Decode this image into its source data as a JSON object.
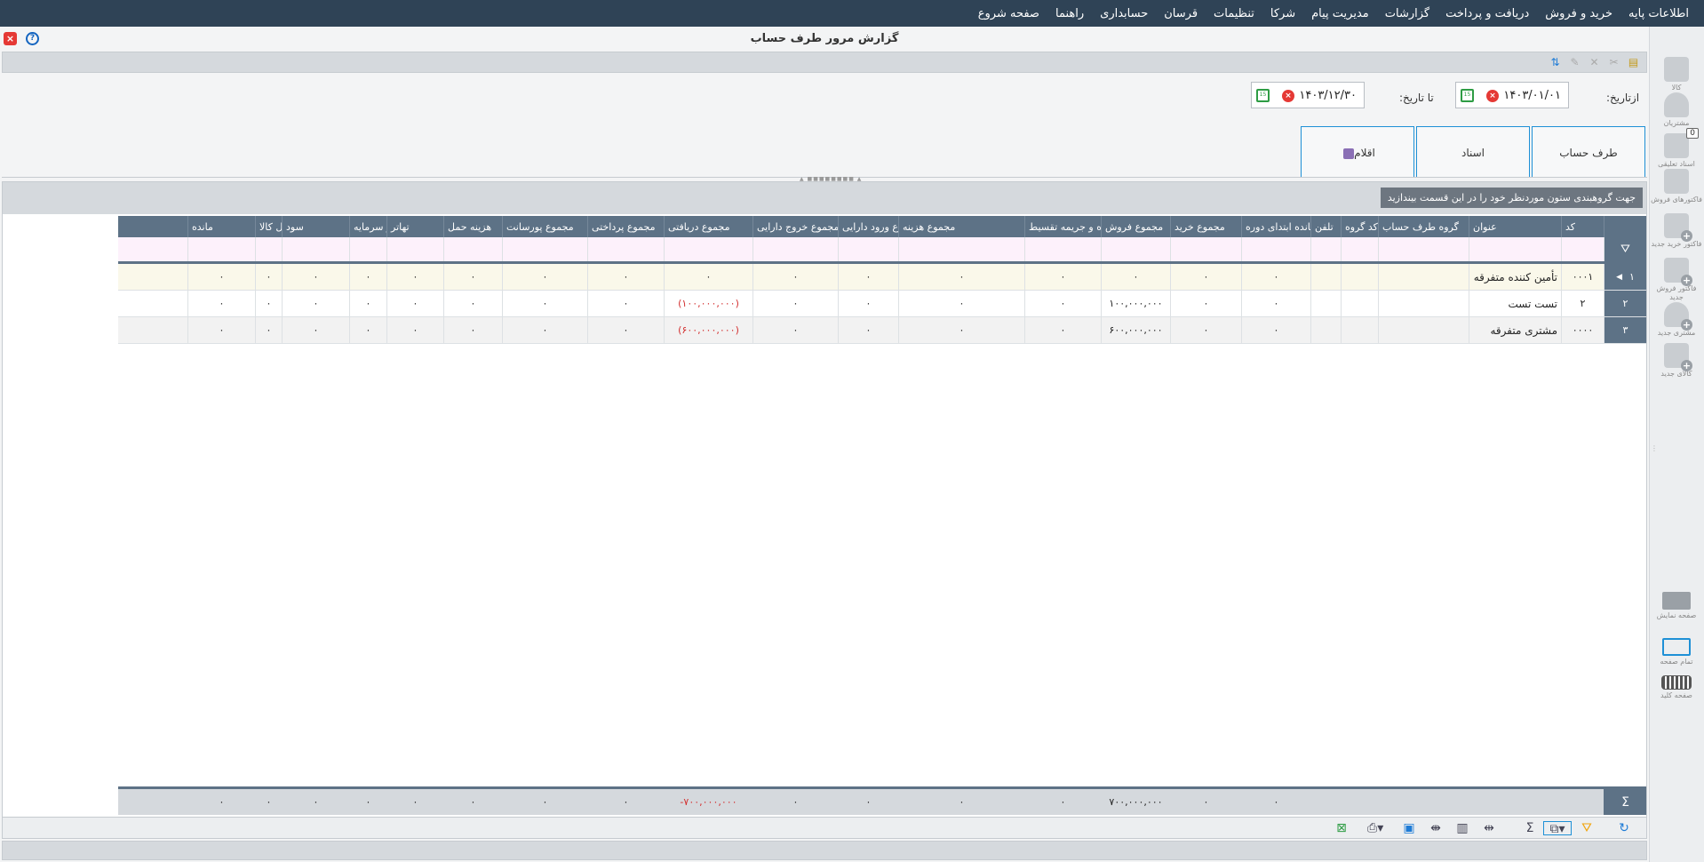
{
  "menu": [
    "اطلاعات پایه",
    "خرید و فروش",
    "دریافت و پرداخت",
    "گزارشات",
    "مدیریت پیام",
    "شرکا",
    "تنظیمات",
    "قرسان",
    "حسابداری",
    "راهنما",
    "صفحه شروع"
  ],
  "window": {
    "title": "گزارش مرور طرف حساب",
    "close": "×",
    "help": "?"
  },
  "sidebar": {
    "items": [
      "کالا",
      "مشتریان",
      "اسناد تعلیقی",
      "فاکتورهای فروش",
      "فاکتور خرید جدید",
      "فاکتور فروش جدید",
      "مشتری جدید",
      "کالای جدید",
      "صفحه نمایش",
      "تمام صفحه",
      "صفحه کلید"
    ],
    "badge": "0"
  },
  "filters": {
    "from_label": "ازتاریخ:",
    "from_value": "۱۴۰۳/۰۱/۰۱",
    "to_label": "تا تاریخ:",
    "to_value": "۱۴۰۳/۱۲/۳۰",
    "calendar_text": "15",
    "clear_text": "×",
    "buttons": [
      "طرف حساب",
      "اسناد",
      "اقلام"
    ]
  },
  "grid": {
    "group_hint": "جهت گروهبندی ستون موردنظر خود را در این قسمت بیندازید",
    "columns": [
      "کد",
      "عنوان",
      "گروه طرف حساب",
      "کد گروه",
      "تلفن",
      "مانده ابتدای دوره",
      "مجموع خرید",
      "مجموع فروش",
      "مجموع بهره و جریمه تقسیط",
      "مجموع هزینه",
      "مجموع ورود دارایی",
      "مجموع خروج دارایی",
      "مجموع دریافتی",
      "مجموع پرداختی",
      "مجموع پورسانت",
      "هزینه حمل",
      "تهاتر",
      "تغییر سرمایه",
      "سود",
      "اجرت تبدیل کالا",
      "مانده"
    ],
    "filter_icon": "⛛",
    "rows": [
      {
        "index": "۱",
        "arrow": "◀",
        "cells": [
          "۰۰۰۱",
          "تأمین کننده متفرقه",
          "",
          "",
          "",
          "۰",
          "۰",
          "۰",
          "۰",
          "۰",
          "۰",
          "۰",
          "۰",
          "۰",
          "۰",
          "۰",
          "۰",
          "۰",
          "۰",
          "۰",
          "۰"
        ]
      },
      {
        "index": "۲",
        "arrow": "",
        "cells": [
          "۲",
          "تست تست",
          "",
          "",
          "",
          "۰",
          "۰",
          "۱۰۰,۰۰۰,۰۰۰",
          "۰",
          "۰",
          "۰",
          "۰",
          "(۱۰۰,۰۰۰,۰۰۰)",
          "۰",
          "۰",
          "۰",
          "۰",
          "۰",
          "۰",
          "۰",
          "۰"
        ]
      },
      {
        "index": "۳",
        "arrow": "",
        "cells": [
          "۰۰۰۰",
          "مشتری متفرقه",
          "",
          "",
          "",
          "۰",
          "۰",
          "۶۰۰,۰۰۰,۰۰۰",
          "۰",
          "۰",
          "۰",
          "۰",
          "(۶۰۰,۰۰۰,۰۰۰)",
          "۰",
          "۰",
          "۰",
          "۰",
          "۰",
          "۰",
          "۰",
          "۰"
        ]
      }
    ],
    "footer_icon": "Σ",
    "footer": [
      "",
      "",
      "",
      "",
      "",
      "۰",
      "۰",
      "۷۰۰,۰۰۰,۰۰۰",
      "۰",
      "۰",
      "۰",
      "۰",
      "۷۰۰,۰۰۰,۰۰۰-",
      "۰",
      "۰",
      "۰",
      "۰",
      "۰",
      "۰",
      "۰",
      "۰"
    ]
  }
}
